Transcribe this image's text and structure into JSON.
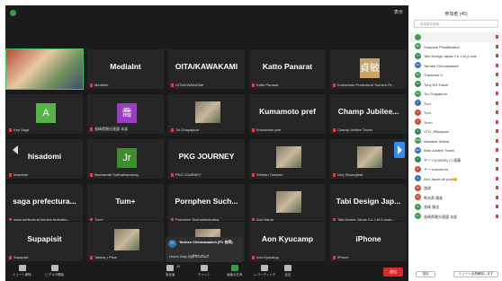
{
  "meeting": {
    "view_label": "表示",
    "tiles": [
      {
        "name": "",
        "label": "",
        "type": "photo"
      },
      {
        "name": "MediaInt",
        "label": "MediaInt",
        "type": "name"
      },
      {
        "name": "OITA/KAWAKAMI",
        "label": "OITA/KAWAKAMI",
        "type": "name"
      },
      {
        "name": "Katto Panarat",
        "label": "Katto Panarat",
        "type": "name"
      },
      {
        "name": "",
        "label": "Kumamoto Prefectural Tourism Fe...",
        "type": "avatar",
        "avatar_text": "貞敏",
        "avatar_color": "#c8a26a"
      },
      {
        "name": "",
        "label": "Key Saga",
        "type": "avatar",
        "avatar_text": "A",
        "avatar_color": "#55b348"
      },
      {
        "name": "",
        "label": "長崎県観光連盟 本部",
        "type": "avatar",
        "avatar_text": "喬",
        "avatar_color": "#9b3fc2"
      },
      {
        "name": "",
        "label": "Tui Chayaphat",
        "type": "photo"
      },
      {
        "name": "Kumamoto pref",
        "label": "Kumamoto pref",
        "type": "name"
      },
      {
        "name": "Champ Jubilee...",
        "label": "Champ Jubilee Travel",
        "type": "name"
      },
      {
        "name": "hisadomi",
        "label": "hisadomi",
        "type": "name"
      },
      {
        "name": "",
        "label": "Nontawuth Sutthathamrong",
        "type": "avatar",
        "avatar_text": "Jr",
        "avatar_color": "#3f8d2f"
      },
      {
        "name": "PKG JOURNEY",
        "label": "PKG JOURNEY",
        "type": "name"
      },
      {
        "name": "",
        "label": "Shimbo Traveler",
        "type": "photo"
      },
      {
        "name": "",
        "label": "Ichy Siwongthai",
        "type": "photo"
      },
      {
        "name": "saga prefectura...",
        "label": "saga prefectural tourism federatio...",
        "type": "name"
      },
      {
        "name": "Tum+",
        "label": "Tum+",
        "type": "name"
      },
      {
        "name": "Pornphen Such...",
        "label": "Pornphen Sucharitkulpatpa",
        "type": "name"
      },
      {
        "name": "",
        "label": "Aon Narue",
        "type": "photo"
      },
      {
        "name": "Tabi Design Jap...",
        "label": "Tabi Design Japan Co.,Ltd (Londo...",
        "type": "name"
      },
      {
        "name": "Supapisit",
        "label": "Supapisit",
        "type": "name"
      },
      {
        "name": "",
        "label": "Tatana_i Piwe",
        "type": "photo"
      },
      {
        "name": "",
        "label": "",
        "type": "photo"
      },
      {
        "name": "Aon Kyucamp",
        "label": "Aon Kyucamp",
        "type": "name"
      },
      {
        "name": "iPhone",
        "label": "iPhone",
        "type": "name"
      }
    ]
  },
  "toast": {
    "initials": "TC",
    "name": "Tarinee Chinnawasich (P1 合同)",
    "message": "Home Stay อยู่ที่ฟิลิปปินส์"
  },
  "toolbar": {
    "items": [
      {
        "label": "ミュート解除",
        "icon": "mic-icon"
      },
      {
        "label": "ビデオの開始",
        "icon": "video-icon"
      },
      {
        "label": "参加者",
        "icon": "participants-icon",
        "count": "45"
      },
      {
        "label": "チャット",
        "icon": "chat-icon"
      },
      {
        "label": "画面の共有",
        "icon": "share-icon"
      },
      {
        "label": "レコーディング",
        "icon": "record-icon"
      },
      {
        "label": "反応",
        "icon": "reactions-icon"
      }
    ],
    "end_label": "退出"
  },
  "panel": {
    "title": "参加者 (45)",
    "search_placeholder": "参加者を検索",
    "participants": [
      {
        "initials": "",
        "name": "",
        "color": "#3f9d4e"
      },
      {
        "initials": "SP",
        "name": "Sunparin Phuditkrabut",
        "color": "#3f9d4e"
      },
      {
        "initials": "TD",
        "name": "Tabi Design Japan Co.,Ltd (Lond...",
        "color": "#2e8b57"
      },
      {
        "initials": "TC",
        "name": "Tarinee Chinnawasich",
        "color": "#3a6fb6"
      },
      {
        "initials": "TV",
        "name": "Thanichai V.",
        "color": "#3f9d4e"
      },
      {
        "initials": "TN",
        "name": "Tony NS Travel",
        "color": "#2e8b57"
      },
      {
        "initials": "TC",
        "name": "Tui Chayaphat",
        "color": "#3f9d4e"
      },
      {
        "initials": "T",
        "name": "Tum",
        "color": "#3a6fb6"
      },
      {
        "initials": "T",
        "name": "Tum",
        "color": "#d14b3a"
      },
      {
        "initials": "T",
        "name": "Tum+",
        "color": "#d14b3a"
      },
      {
        "initials": "V",
        "name": "VTG_Rikkaporn",
        "color": "#2e8b57"
      },
      {
        "initials": "WW",
        "name": "Wanalee Waiha",
        "color": "#3f9d4e"
      },
      {
        "initials": "WJ",
        "name": "Wan Jubilee Travel",
        "color": "#3a6fb6"
      },
      {
        "initials": "Y",
        "name": "ヤーソ(OASIS) 川 遠藤",
        "color": "#2e8b57"
      },
      {
        "initials": "F",
        "name": "ドー manunuru",
        "color": "#d14b3a"
      },
      {
        "initials": "A",
        "name": "Aso Japan all post😊",
        "color": "#3a6fb6"
      },
      {
        "initials": "W",
        "name": "渡邊",
        "color": "#d14b3a"
      },
      {
        "initials": "N",
        "name": "熊本県 陽星",
        "color": "#d14b3a"
      },
      {
        "initials": "S",
        "name": "長崎 慎也",
        "color": "#3f9d4e"
      },
      {
        "initials": "N",
        "name": "長崎県観光連盟 本部",
        "color": "#3f9d4e"
      }
    ],
    "invite_label": "招待",
    "mute_all_label": "ミュート全員解除します"
  }
}
